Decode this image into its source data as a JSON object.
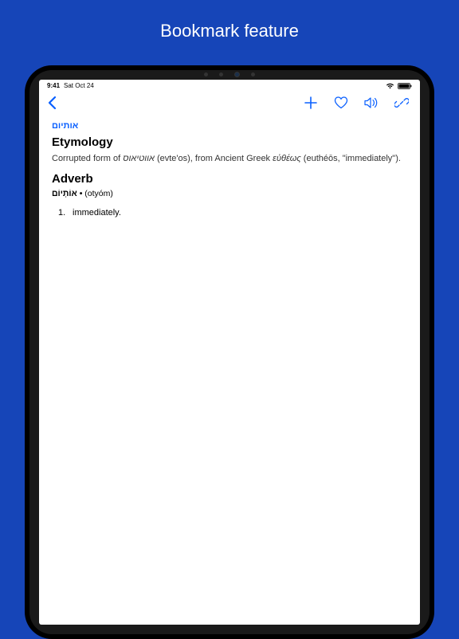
{
  "promo": {
    "title": "Bookmark feature"
  },
  "status": {
    "time": "9:41",
    "date": "Sat Oct 24"
  },
  "entry": {
    "headword": "אותיום",
    "sections": {
      "etymology": {
        "title": "Etymology",
        "prefix": "Corrupted form of ",
        "src1": "אווטיאוס",
        "src1_tr": " (evte'os), from Ancient Greek ",
        "src2": "εὐθέως",
        "src2_tr": " (euthéōs, \"immediately\")."
      },
      "adverb": {
        "title": "Adverb",
        "bold": "אוֹתְיוֹם •",
        "tr": " (otyóm)"
      }
    },
    "definitions": [
      {
        "n": "1.",
        "text": "immediately."
      }
    ]
  }
}
